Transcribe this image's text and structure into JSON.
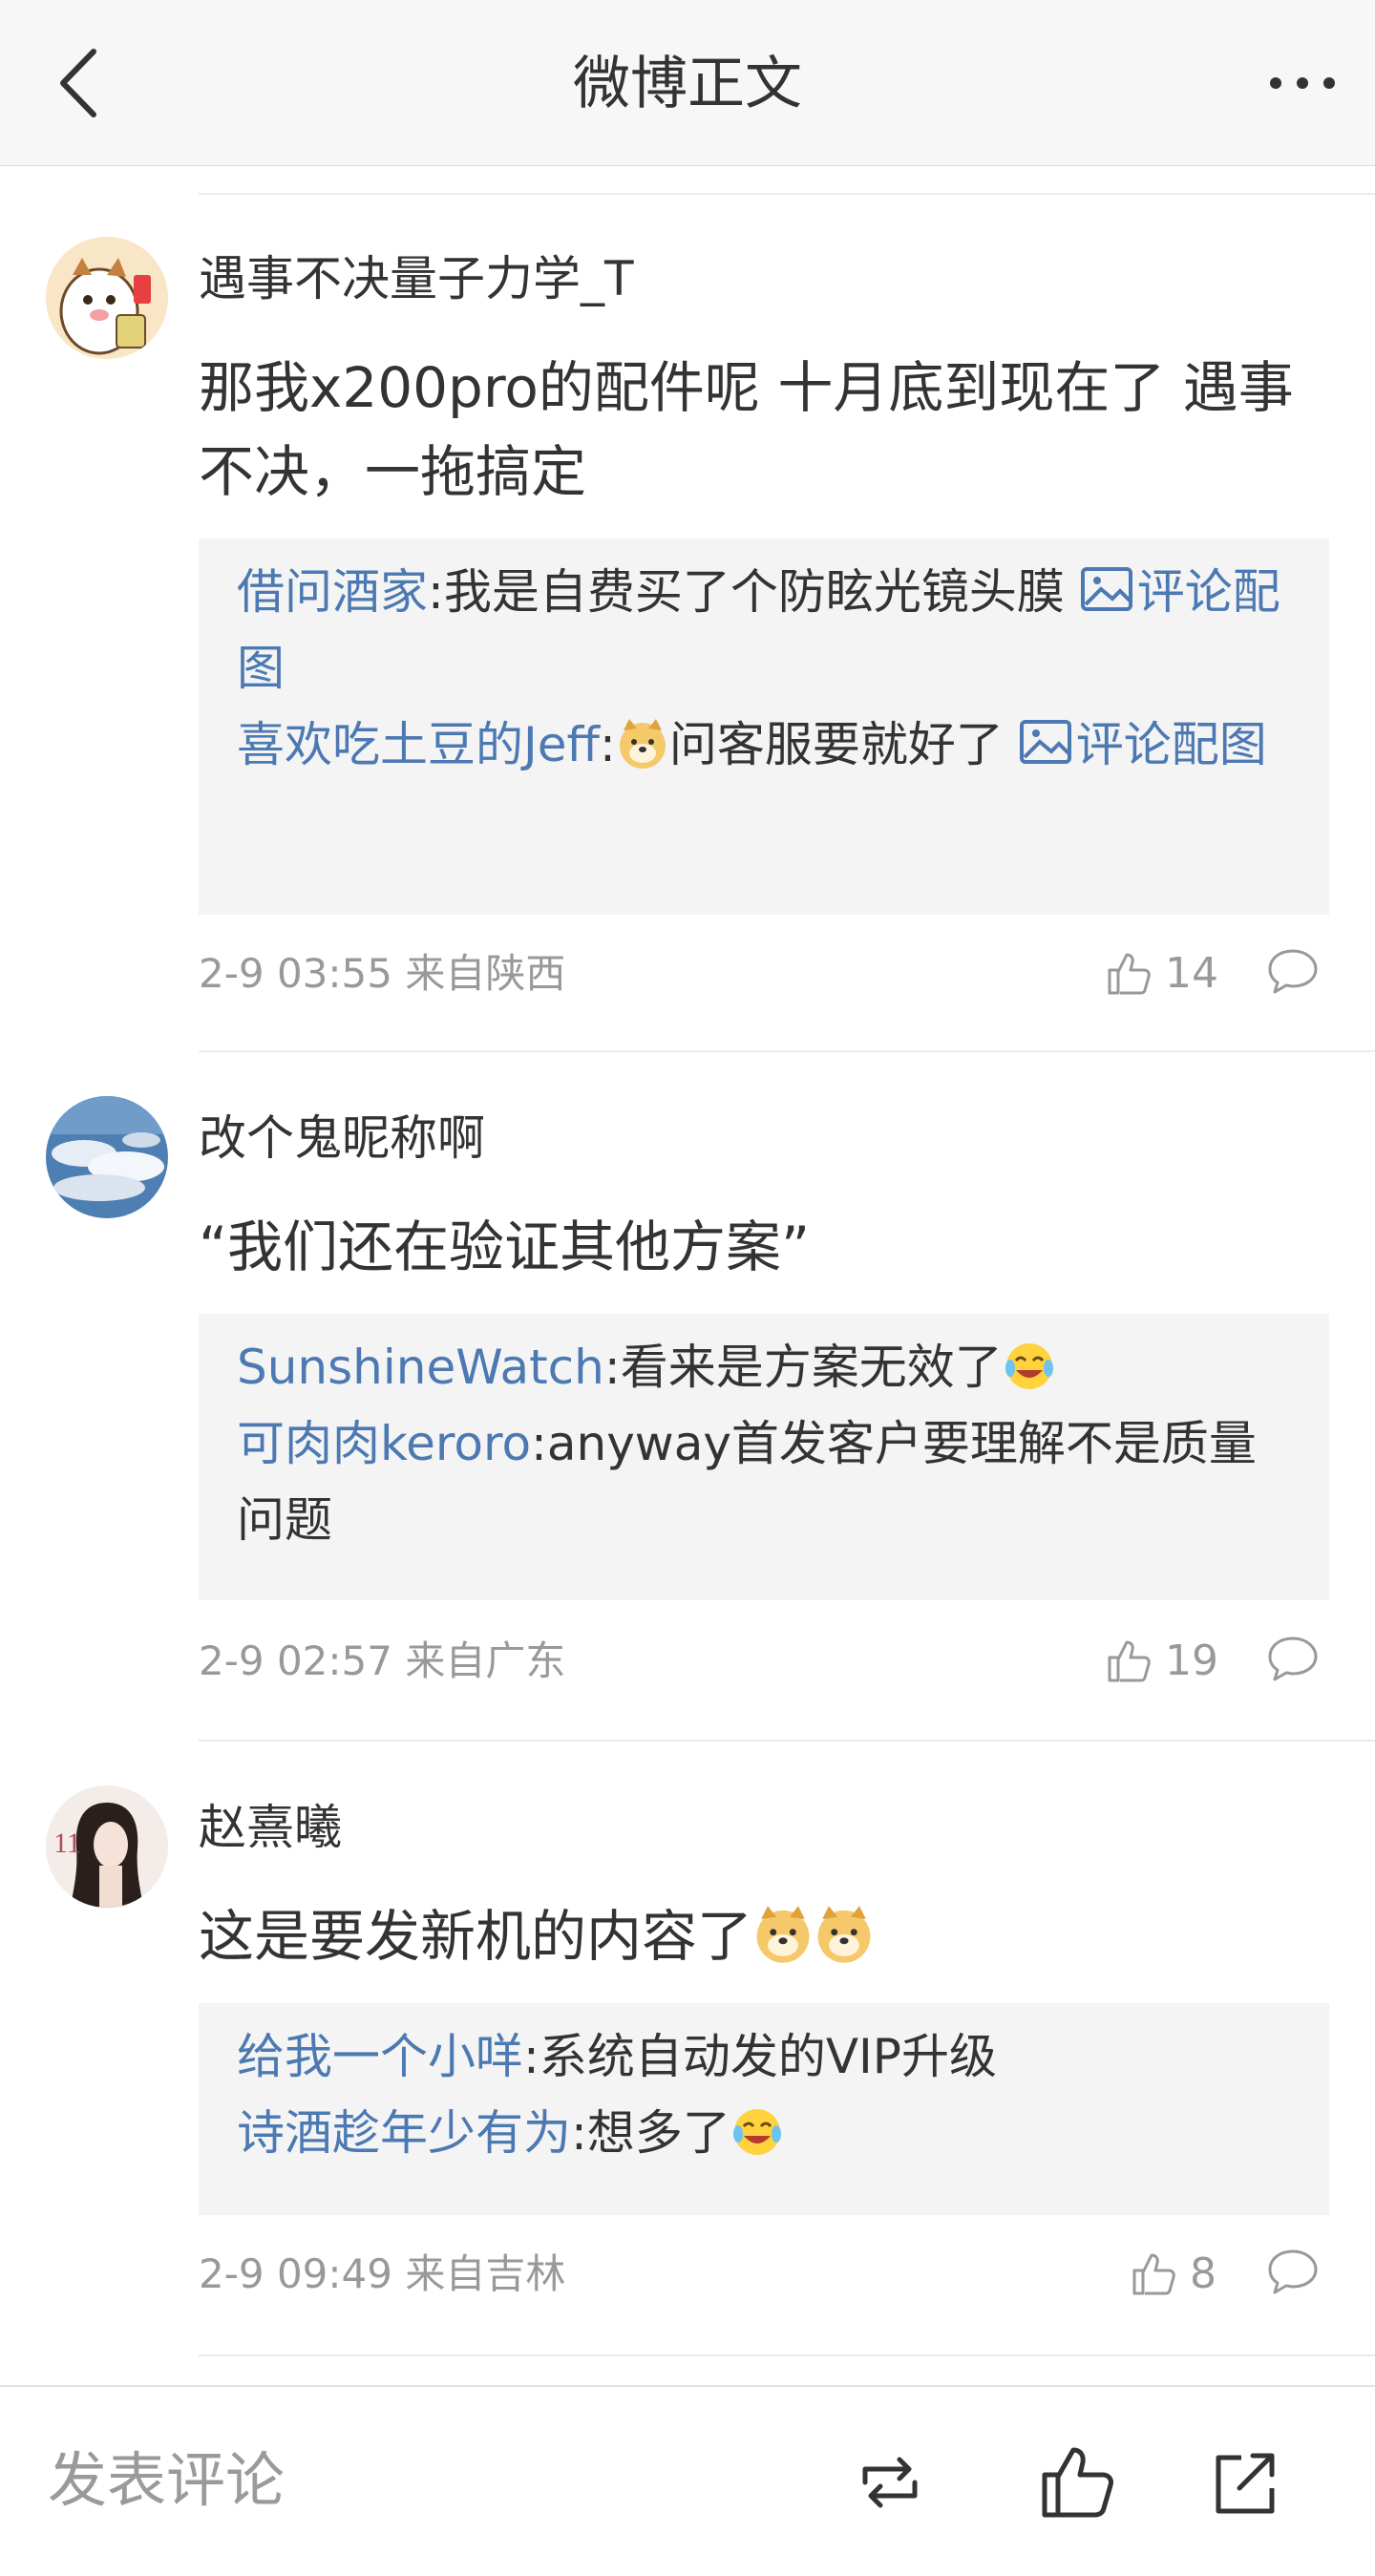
{
  "header": {
    "title": "微博正文",
    "back_icon": "chevron-left-icon",
    "more_icon": "more-dots-icon"
  },
  "comments": [
    {
      "username": "遇事不决量子力学_T",
      "text": "那我x200pro的配件呢 十月底到现在了 遇事不决，一拖搞定",
      "replies": [
        {
          "name": "借问酒家",
          "text": ":我是自费买了个防眩光镜头膜 ",
          "pic": "评论配图"
        },
        {
          "name": "喜欢吃土豆的Jeff",
          "text": "问客服要就好了 ",
          "pic": "评论配图",
          "emoji_before": "doge"
        }
      ],
      "time": "2-9 03:55",
      "location": "来自陕西",
      "likes": "14"
    },
    {
      "username": "改个鬼昵称啊",
      "text": "“我们还在验证其他方案”",
      "replies": [
        {
          "name": "SunshineWatch",
          "text": ":看来是方案无效了",
          "emoji_after": "laugh-cry"
        },
        {
          "name": "可肉肉keroro",
          "text": ":anyway首发客户要理解不是质量问题"
        }
      ],
      "time": "2-9 02:57",
      "location": "来自广东",
      "likes": "19"
    },
    {
      "username": "赵熹曦",
      "text": "这是要发新机的内容了",
      "replies": [
        {
          "name": "给我一个小咩",
          "text": ":系统自动发的VIP升级"
        },
        {
          "name": "诗酒趁年少有为",
          "text": ":想多了",
          "emoji_after": "laugh-cry"
        }
      ],
      "time": "2-9 09:49",
      "location": "来自吉林",
      "likes": "8",
      "avatar_badge": "11"
    }
  ],
  "bottom_bar": {
    "placeholder": "发表评论",
    "icons": [
      "repost-icon",
      "like-icon",
      "share-icon"
    ]
  },
  "colors": {
    "link": "#4c79b2",
    "meta": "#999999",
    "reply_bg": "#f4f4f4"
  }
}
